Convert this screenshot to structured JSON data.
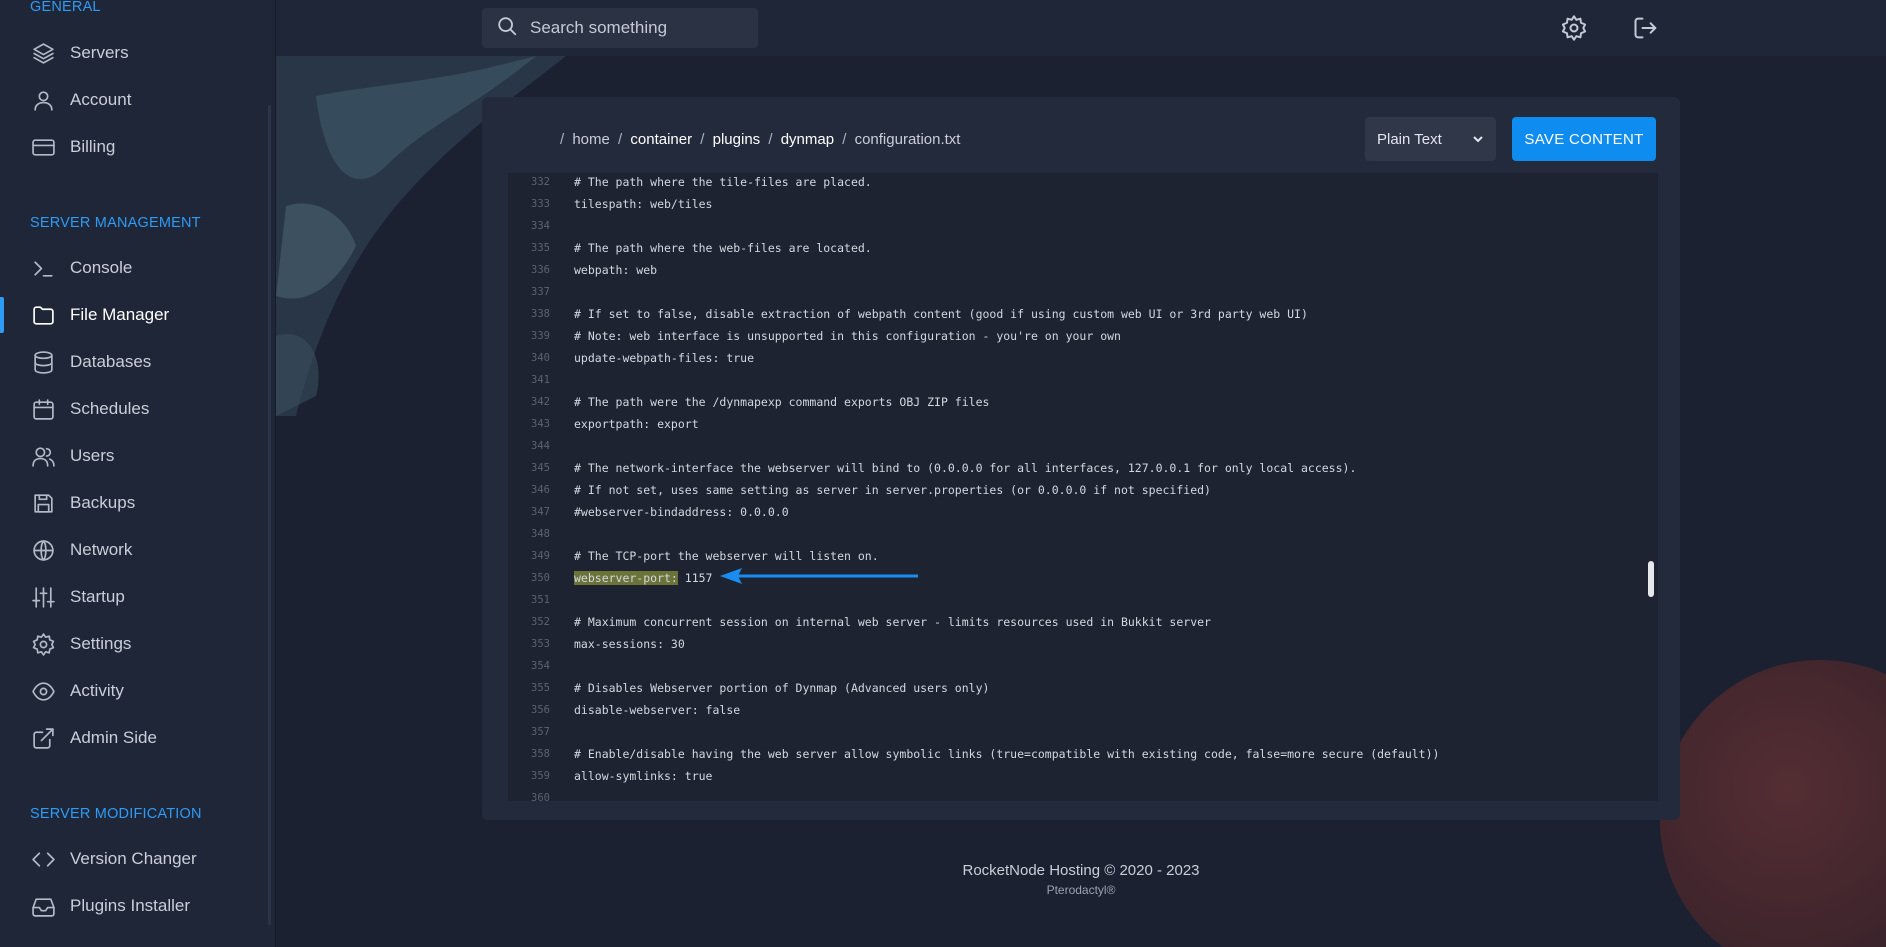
{
  "sidebar": {
    "sections": [
      {
        "title": "GENERAL"
      },
      {
        "title": "SERVER MANAGEMENT"
      },
      {
        "title": "SERVER MODIFICATION"
      }
    ],
    "items": [
      {
        "label": "Servers",
        "icon": "layers-icon"
      },
      {
        "label": "Account",
        "icon": "user-icon"
      },
      {
        "label": "Billing",
        "icon": "credit-card-icon"
      },
      {
        "label": "Console",
        "icon": "terminal-icon"
      },
      {
        "label": "File Manager",
        "icon": "folder-icon",
        "active": true
      },
      {
        "label": "Databases",
        "icon": "database-icon"
      },
      {
        "label": "Schedules",
        "icon": "calendar-icon"
      },
      {
        "label": "Users",
        "icon": "users-icon"
      },
      {
        "label": "Backups",
        "icon": "save-icon"
      },
      {
        "label": "Network",
        "icon": "globe-icon"
      },
      {
        "label": "Startup",
        "icon": "sliders-icon"
      },
      {
        "label": "Settings",
        "icon": "gear-icon"
      },
      {
        "label": "Activity",
        "icon": "eye-icon"
      },
      {
        "label": "Admin Side",
        "icon": "external-link-icon"
      },
      {
        "label": "Version Changer",
        "icon": "code-icon"
      },
      {
        "label": "Plugins Installer",
        "icon": "inbox-icon"
      }
    ]
  },
  "topbar": {
    "search_placeholder": "Search something",
    "icons": [
      "gear-icon",
      "logout-icon"
    ]
  },
  "editor": {
    "breadcrumb": {
      "lead_sep": "/",
      "segments": [
        "home",
        "container",
        "plugins",
        "dynmap",
        "configuration.txt"
      ]
    },
    "language_select": "Plain Text",
    "save_label": "SAVE CONTENT",
    "lines": [
      {
        "n": "332",
        "text": "# The path where the tile-files are placed."
      },
      {
        "n": "333",
        "text": "tilespath: web/tiles"
      },
      {
        "n": "334",
        "text": ""
      },
      {
        "n": "335",
        "text": "# The path where the web-files are located."
      },
      {
        "n": "336",
        "text": "webpath: web"
      },
      {
        "n": "337",
        "text": ""
      },
      {
        "n": "338",
        "text": "# If set to false, disable extraction of webpath content (good if using custom web UI or 3rd party web UI)"
      },
      {
        "n": "339",
        "text": "# Note: web interface is unsupported in this configuration - you're on your own"
      },
      {
        "n": "340",
        "text": "update-webpath-files: true"
      },
      {
        "n": "341",
        "text": ""
      },
      {
        "n": "342",
        "text": "# The path were the /dynmapexp command exports OBJ ZIP files"
      },
      {
        "n": "343",
        "text": "exportpath: export"
      },
      {
        "n": "344",
        "text": ""
      },
      {
        "n": "345",
        "text": "# The network-interface the webserver will bind to (0.0.0.0 for all interfaces, 127.0.0.1 for only local access)."
      },
      {
        "n": "346",
        "text": "# If not set, uses same setting as server in server.properties (or 0.0.0.0 if not specified)"
      },
      {
        "n": "347",
        "text": "#webserver-bindaddress: 0.0.0.0"
      },
      {
        "n": "348",
        "text": ""
      },
      {
        "n": "349",
        "text": "# The TCP-port the webserver will listen on."
      },
      {
        "n": "350",
        "text": " 1157",
        "highlight": "webserver-port:"
      },
      {
        "n": "351",
        "text": ""
      },
      {
        "n": "352",
        "text": "# Maximum concurrent session on internal web server - limits resources used in Bukkit server"
      },
      {
        "n": "353",
        "text": "max-sessions: 30"
      },
      {
        "n": "354",
        "text": ""
      },
      {
        "n": "355",
        "text": "# Disables Webserver portion of Dynmap (Advanced users only)"
      },
      {
        "n": "356",
        "text": "disable-webserver: false"
      },
      {
        "n": "357",
        "text": ""
      },
      {
        "n": "358",
        "text": "# Enable/disable having the web server allow symbolic links (true=compatible with existing code, false=more secure (default))"
      },
      {
        "n": "359",
        "text": "allow-symlinks: true"
      },
      {
        "n": "360",
        "text": ""
      }
    ]
  },
  "footer": {
    "main": "RocketNode Hosting © 2020 - 2023",
    "sub": "Pterodactyl®"
  },
  "colors": {
    "accent": "#2e9bf5",
    "save_button": "#0f8cf0",
    "highlight": "#6b7339",
    "arrow": "#1a8cf0"
  }
}
